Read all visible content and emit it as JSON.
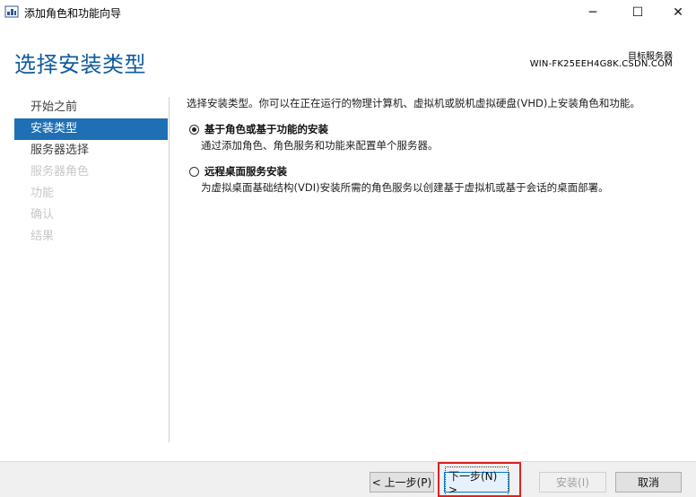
{
  "window": {
    "title": "添加角色和功能向导",
    "minimize_glyph": "─",
    "maximize_glyph": "☐",
    "close_glyph": "✕"
  },
  "header": {
    "title": "选择安装类型",
    "target_label": "目标服务器",
    "target_server": "WIN-FK25EEH4G8K.CSDN.COM"
  },
  "nav": {
    "items": [
      {
        "label": "开始之前",
        "state": "normal"
      },
      {
        "label": "安装类型",
        "state": "active"
      },
      {
        "label": "服务器选择",
        "state": "normal"
      },
      {
        "label": "服务器角色",
        "state": "disabled"
      },
      {
        "label": "功能",
        "state": "disabled"
      },
      {
        "label": "确认",
        "state": "disabled"
      },
      {
        "label": "结果",
        "state": "disabled"
      }
    ]
  },
  "content": {
    "intro": "选择安装类型。你可以在正在运行的物理计算机、虚拟机或脱机虚拟硬盘(VHD)上安装角色和功能。",
    "options": [
      {
        "label": "基于角色或基于功能的安装",
        "description": "通过添加角色、角色服务和功能来配置单个服务器。",
        "selected": true
      },
      {
        "label": "远程桌面服务安装",
        "description": "为虚拟桌面基础结构(VDI)安装所需的角色服务以创建基于虚拟机或基于会话的桌面部署。",
        "selected": false
      }
    ]
  },
  "footer": {
    "prev_label": "< 上一步(P)",
    "next_label": "下一步(N) >",
    "install_label": "安装(I)",
    "cancel_label": "取消"
  },
  "colors": {
    "accent": "#1f6fb5",
    "title_blue": "#0f5b9e",
    "highlight_red": "#e02020"
  },
  "icons": {
    "app": "server-manager-icon"
  }
}
